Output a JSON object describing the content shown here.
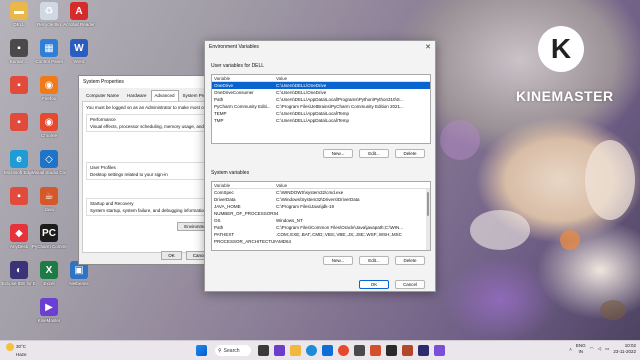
{
  "colors": {
    "selection": "#0a64d0",
    "kinemaster_text": "#ffffff"
  },
  "desktop_icons": [
    {
      "label": "DELL",
      "icon": "folder-icon"
    },
    {
      "label": "Recycle Bin",
      "icon": "recycle-bin-icon"
    },
    {
      "label": "Acrobat Reader",
      "icon": "acrobat-icon"
    },
    {
      "label": "Kumar ...",
      "icon": "shortcut-icon"
    },
    {
      "label": "Control Panel",
      "icon": "control-panel-icon"
    },
    {
      "label": "Word",
      "icon": "word-icon"
    },
    {
      "label": "",
      "icon": "app-icon"
    },
    {
      "label": "Firefox",
      "icon": "firefox-icon"
    },
    {
      "label": "",
      "icon": "app-icon"
    },
    {
      "label": "Chrome",
      "icon": "chrome-icon"
    },
    {
      "label": "Microsoft Edge",
      "icon": "edge-icon"
    },
    {
      "label": "Visual Studio Code",
      "icon": "vscode-icon"
    },
    {
      "label": "",
      "icon": "app-icon"
    },
    {
      "label": "AnyDesk",
      "icon": "anydesk-icon"
    },
    {
      "label": "PyCharm Community",
      "icon": "pycharm-icon"
    },
    {
      "label": "Java",
      "icon": "java-icon"
    },
    {
      "label": "Excel",
      "icon": "excel-icon"
    },
    {
      "label": "Eclipse IDE for Enterprise",
      "icon": "eclipse-icon"
    },
    {
      "label": "Netbeans",
      "icon": "netbeans-icon"
    },
    {
      "label": "KineMaster",
      "icon": "kinemaster-icon"
    }
  ],
  "kinemaster": {
    "logo_letter": "K",
    "watermark": "KINEMASTER"
  },
  "system_properties": {
    "title": "System Properties",
    "tabs": [
      "Computer Name",
      "Hardware",
      "Advanced",
      "System Protection"
    ],
    "active_tab": "Advanced",
    "admin_note": "You must be logged on as an Administrator to make most of these changes.",
    "performance_title": "Performance",
    "performance_text": "Visual effects, processor scheduling, memory usage, and virtual memory",
    "user_profiles_title": "User Profiles",
    "user_profiles_text": "Desktop settings related to your sign-in",
    "startup_title": "Startup and Recovery",
    "startup_text": "System startup, system failure, and debugging information",
    "env_button": "Environment Variables...",
    "ok": "OK",
    "cancel": "Cancel",
    "apply": "Apply"
  },
  "env_dialog": {
    "title": "Environment Variables",
    "user_section": "User variables for DELL",
    "col_variable": "Variable",
    "col_value": "Value",
    "user_vars": [
      {
        "variable": "OneDrive",
        "value": "C:\\Users\\DELL\\OneDrive",
        "selected": true
      },
      {
        "variable": "OneDriveConsumer",
        "value": "C:\\Users\\DELL\\OneDrive"
      },
      {
        "variable": "Path",
        "value": "C:\\Users\\DELL\\AppData\\Local\\Programs\\Python\\Python310\\S..."
      },
      {
        "variable": "PyCharm Community Editi...",
        "value": "C:\\Program Files\\JetBrains\\PyCharm Community Edition 2021..."
      },
      {
        "variable": "TEMP",
        "value": "C:\\Users\\DELL\\AppData\\Local\\Temp"
      },
      {
        "variable": "TMP",
        "value": "C:\\Users\\DELL\\AppData\\Local\\Temp"
      }
    ],
    "system_section": "System variables",
    "system_vars": [
      {
        "variable": "ComSpec",
        "value": "C:\\WINDOWS\\system32\\cmd.exe"
      },
      {
        "variable": "DriverData",
        "value": "C:\\Windows\\System32\\Drivers\\DriverData"
      },
      {
        "variable": "JAVA_HOME",
        "value": "C:\\Program Files\\Java\\jdk-19"
      },
      {
        "variable": "NUMBER_OF_PROCESSORS",
        "value": "4"
      },
      {
        "variable": "OS",
        "value": "Windows_NT"
      },
      {
        "variable": "Path",
        "value": "C:\\Program Files\\Common Files\\Oracle\\Java\\javapath;C:\\WIN..."
      },
      {
        "variable": "PATHEXT",
        "value": ".COM;.EXE;.BAT;.CMD;.VBS;.VBE;.JS;.JSE;.WSF;.WSH;.MSC"
      },
      {
        "variable": "PROCESSOR_ARCHITECTURE",
        "value": "AMD64"
      }
    ],
    "new": "New...",
    "edit": "Edit...",
    "delete": "Delete",
    "ok": "OK",
    "cancel": "Cancel"
  },
  "taskbar": {
    "weather_temp": "30°C",
    "weather_desc": "Haze",
    "search": "Search",
    "lang": "ENG",
    "region": "IN",
    "time": "10:02",
    "date": "23-11-2022"
  }
}
